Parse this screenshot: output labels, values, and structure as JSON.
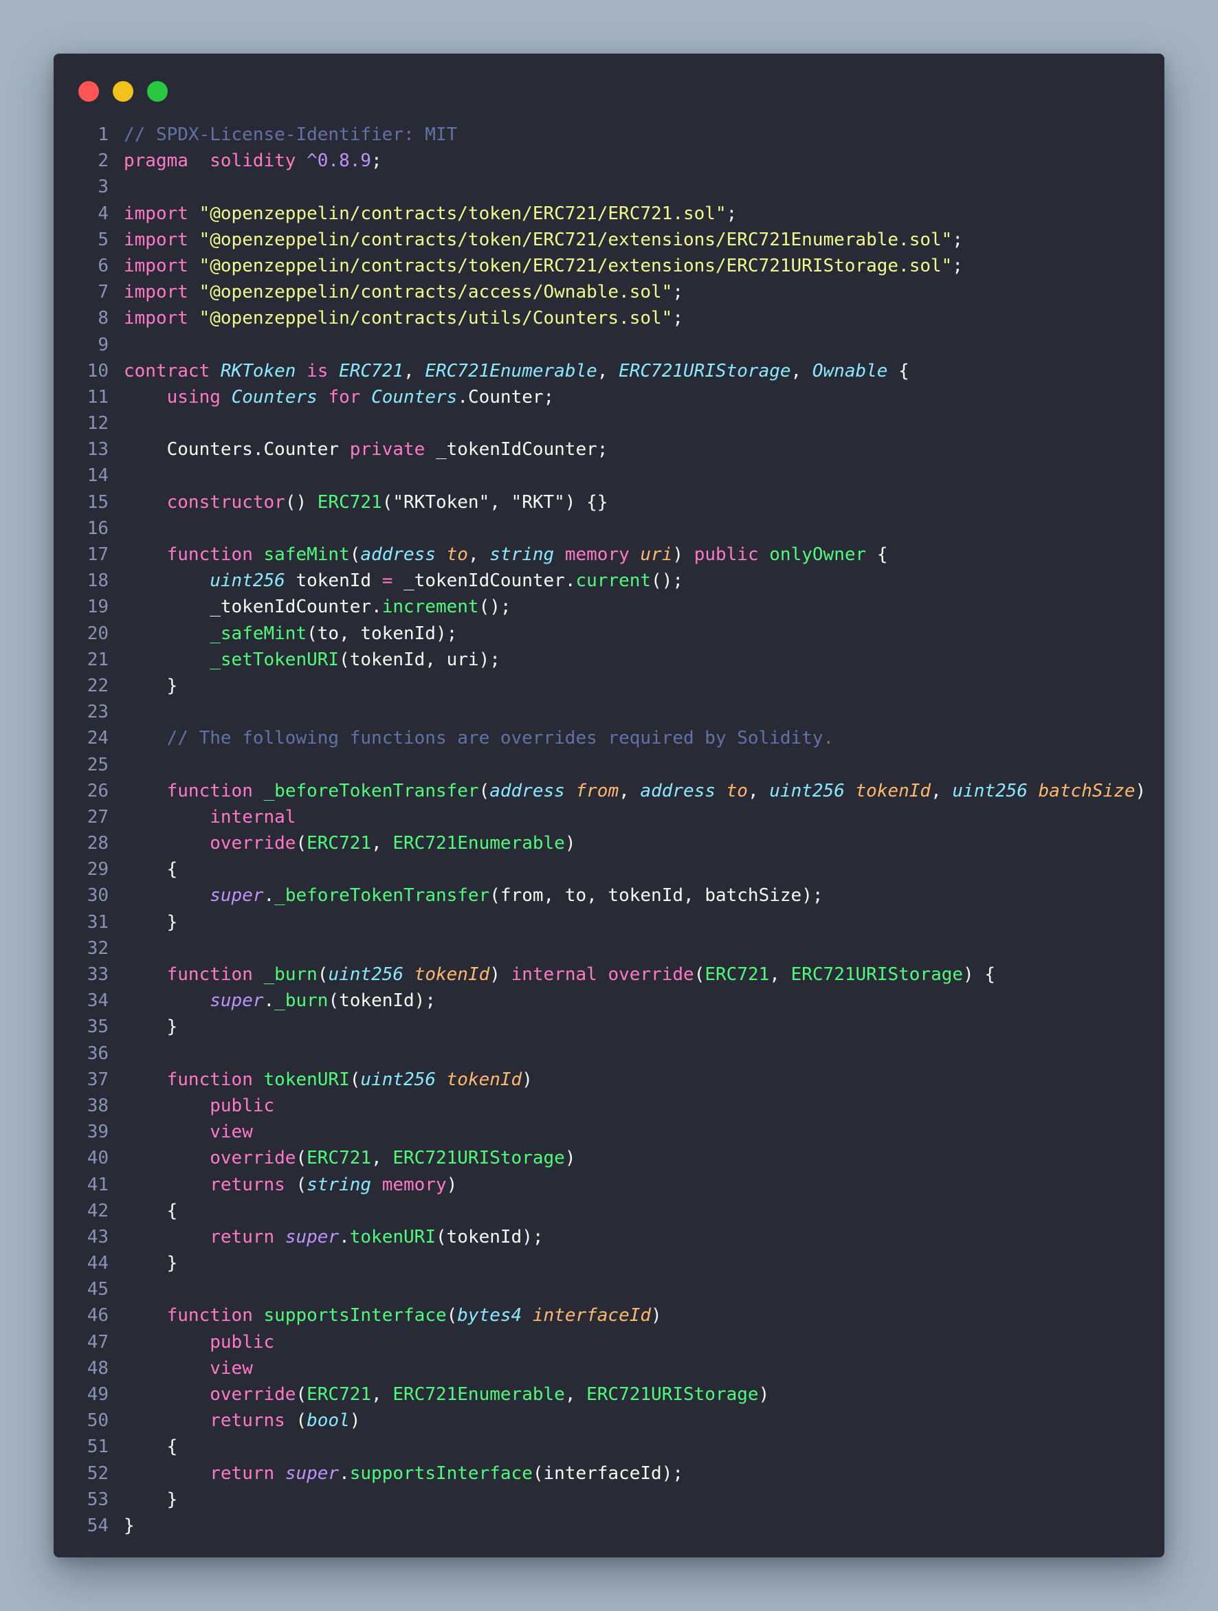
{
  "window": {
    "controls": [
      "close",
      "minimize",
      "maximize"
    ]
  },
  "colors": {
    "background": "#a5b3c1",
    "editor_bg": "#282a36",
    "comment": "#6272a4",
    "keyword": "#ff79c6",
    "string": "#f1fa8c",
    "number": "#bd93f9",
    "type": "#8be9fd",
    "function": "#50fa7b",
    "param": "#ffb86c",
    "plain": "#f8f8f2"
  },
  "lines": [
    [
      [
        "c",
        "// SPDX-License-Identifier: MIT"
      ]
    ],
    [
      [
        "k",
        "pragma"
      ],
      [
        "",
        "  "
      ],
      [
        "k",
        "solidity"
      ],
      [
        "",
        " "
      ],
      [
        "n",
        "^0.8.9"
      ],
      [
        "",
        ";"
      ]
    ],
    [],
    [
      [
        "k",
        "import"
      ],
      [
        "",
        " "
      ],
      [
        "s",
        "\"@openzeppelin/contracts/token/ERC721/ERC721.sol\""
      ],
      [
        "",
        ";"
      ]
    ],
    [
      [
        "k",
        "import"
      ],
      [
        "",
        " "
      ],
      [
        "s",
        "\"@openzeppelin/contracts/token/ERC721/extensions/ERC721Enumerable.sol\""
      ],
      [
        "",
        ";"
      ]
    ],
    [
      [
        "k",
        "import"
      ],
      [
        "",
        " "
      ],
      [
        "s",
        "\"@openzeppelin/contracts/token/ERC721/extensions/ERC721URIStorage.sol\""
      ],
      [
        "",
        ";"
      ]
    ],
    [
      [
        "k",
        "import"
      ],
      [
        "",
        " "
      ],
      [
        "s",
        "\"@openzeppelin/contracts/access/Ownable.sol\""
      ],
      [
        "",
        ";"
      ]
    ],
    [
      [
        "k",
        "import"
      ],
      [
        "",
        " "
      ],
      [
        "s",
        "\"@openzeppelin/contracts/utils/Counters.sol\""
      ],
      [
        "",
        ";"
      ]
    ],
    [],
    [
      [
        "k",
        "contract"
      ],
      [
        "",
        " "
      ],
      [
        "t",
        "RKToken"
      ],
      [
        "",
        " "
      ],
      [
        "k",
        "is"
      ],
      [
        "",
        " "
      ],
      [
        "t",
        "ERC721"
      ],
      [
        "",
        ", "
      ],
      [
        "t",
        "ERC721Enumerable"
      ],
      [
        "",
        ", "
      ],
      [
        "t",
        "ERC721URIStorage"
      ],
      [
        "",
        ", "
      ],
      [
        "t",
        "Ownable"
      ],
      [
        "",
        " {"
      ]
    ],
    [
      [
        "",
        "    "
      ],
      [
        "k",
        "using"
      ],
      [
        "",
        " "
      ],
      [
        "t",
        "Counters"
      ],
      [
        "",
        " "
      ],
      [
        "k",
        "for"
      ],
      [
        "",
        " "
      ],
      [
        "t",
        "Counters"
      ],
      [
        "",
        ".Counter;"
      ]
    ],
    [],
    [
      [
        "",
        "    Counters.Counter "
      ],
      [
        "k",
        "private"
      ],
      [
        "",
        " _tokenIdCounter;"
      ]
    ],
    [],
    [
      [
        "",
        "    "
      ],
      [
        "k",
        "constructor"
      ],
      [
        "",
        "() "
      ],
      [
        "f",
        "ERC721"
      ],
      [
        "",
        "(\"RKToken\", \"RKT\") {}"
      ]
    ],
    [],
    [
      [
        "",
        "    "
      ],
      [
        "k",
        "function"
      ],
      [
        "",
        " "
      ],
      [
        "f",
        "safeMint"
      ],
      [
        "",
        "("
      ],
      [
        "t",
        "address"
      ],
      [
        "",
        " "
      ],
      [
        "p",
        "to"
      ],
      [
        "",
        ", "
      ],
      [
        "t",
        "string"
      ],
      [
        "",
        " "
      ],
      [
        "k",
        "memory"
      ],
      [
        "",
        " "
      ],
      [
        "p",
        "uri"
      ],
      [
        "",
        ") "
      ],
      [
        "k",
        "public"
      ],
      [
        "",
        " "
      ],
      [
        "f",
        "onlyOwner"
      ],
      [
        "",
        " {"
      ]
    ],
    [
      [
        "",
        "        "
      ],
      [
        "t",
        "uint256"
      ],
      [
        "",
        " tokenId "
      ],
      [
        "k",
        "="
      ],
      [
        "",
        " _tokenIdCounter."
      ],
      [
        "f",
        "current"
      ],
      [
        "",
        "();"
      ]
    ],
    [
      [
        "",
        "        _tokenIdCounter."
      ],
      [
        "f",
        "increment"
      ],
      [
        "",
        "();"
      ]
    ],
    [
      [
        "",
        "        "
      ],
      [
        "f",
        "_safeMint"
      ],
      [
        "",
        "(to, tokenId);"
      ]
    ],
    [
      [
        "",
        "        "
      ],
      [
        "f",
        "_setTokenURI"
      ],
      [
        "",
        "(tokenId, uri);"
      ]
    ],
    [
      [
        "",
        "    }"
      ]
    ],
    [],
    [
      [
        "",
        "    "
      ],
      [
        "c",
        "// The following functions are overrides required by Solidity."
      ]
    ],
    [],
    [
      [
        "",
        "    "
      ],
      [
        "k",
        "function"
      ],
      [
        "",
        " "
      ],
      [
        "f",
        "_beforeTokenTransfer"
      ],
      [
        "",
        "("
      ],
      [
        "t",
        "address"
      ],
      [
        "",
        " "
      ],
      [
        "p",
        "from"
      ],
      [
        "",
        ", "
      ],
      [
        "t",
        "address"
      ],
      [
        "",
        " "
      ],
      [
        "p",
        "to"
      ],
      [
        "",
        ", "
      ],
      [
        "t",
        "uint256"
      ],
      [
        "",
        " "
      ],
      [
        "p",
        "tokenId"
      ],
      [
        "",
        ", "
      ],
      [
        "t",
        "uint256"
      ],
      [
        "",
        " "
      ],
      [
        "p",
        "batchSize"
      ],
      [
        "",
        ")"
      ]
    ],
    [
      [
        "",
        "        "
      ],
      [
        "k",
        "internal"
      ]
    ],
    [
      [
        "",
        "        "
      ],
      [
        "k",
        "override"
      ],
      [
        "",
        "("
      ],
      [
        "f",
        "ERC721"
      ],
      [
        "",
        ", "
      ],
      [
        "f",
        "ERC721Enumerable"
      ],
      [
        "",
        ")"
      ]
    ],
    [
      [
        "",
        "    {"
      ]
    ],
    [
      [
        "",
        "        "
      ],
      [
        "v",
        "super"
      ],
      [
        "",
        "."
      ],
      [
        "f",
        "_beforeTokenTransfer"
      ],
      [
        "",
        "(from, to, tokenId, batchSize);"
      ]
    ],
    [
      [
        "",
        "    }"
      ]
    ],
    [],
    [
      [
        "",
        "    "
      ],
      [
        "k",
        "function"
      ],
      [
        "",
        " "
      ],
      [
        "f",
        "_burn"
      ],
      [
        "",
        "("
      ],
      [
        "t",
        "uint256"
      ],
      [
        "",
        " "
      ],
      [
        "p",
        "tokenId"
      ],
      [
        "",
        ") "
      ],
      [
        "k",
        "internal"
      ],
      [
        "",
        " "
      ],
      [
        "k",
        "override"
      ],
      [
        "",
        "("
      ],
      [
        "f",
        "ERC721"
      ],
      [
        "",
        ", "
      ],
      [
        "f",
        "ERC721URIStorage"
      ],
      [
        "",
        ") {"
      ]
    ],
    [
      [
        "",
        "        "
      ],
      [
        "v",
        "super"
      ],
      [
        "",
        "."
      ],
      [
        "f",
        "_burn"
      ],
      [
        "",
        "(tokenId);"
      ]
    ],
    [
      [
        "",
        "    }"
      ]
    ],
    [],
    [
      [
        "",
        "    "
      ],
      [
        "k",
        "function"
      ],
      [
        "",
        " "
      ],
      [
        "f",
        "tokenURI"
      ],
      [
        "",
        "("
      ],
      [
        "t",
        "uint256"
      ],
      [
        "",
        " "
      ],
      [
        "p",
        "tokenId"
      ],
      [
        "",
        ")"
      ]
    ],
    [
      [
        "",
        "        "
      ],
      [
        "k",
        "public"
      ]
    ],
    [
      [
        "",
        "        "
      ],
      [
        "k",
        "view"
      ]
    ],
    [
      [
        "",
        "        "
      ],
      [
        "k",
        "override"
      ],
      [
        "",
        "("
      ],
      [
        "f",
        "ERC721"
      ],
      [
        "",
        ", "
      ],
      [
        "f",
        "ERC721URIStorage"
      ],
      [
        "",
        ")"
      ]
    ],
    [
      [
        "",
        "        "
      ],
      [
        "k",
        "returns"
      ],
      [
        "",
        " ("
      ],
      [
        "t",
        "string"
      ],
      [
        "",
        " "
      ],
      [
        "k",
        "memory"
      ],
      [
        "",
        ")"
      ]
    ],
    [
      [
        "",
        "    {"
      ]
    ],
    [
      [
        "",
        "        "
      ],
      [
        "k",
        "return"
      ],
      [
        "",
        " "
      ],
      [
        "v",
        "super"
      ],
      [
        "",
        "."
      ],
      [
        "f",
        "tokenURI"
      ],
      [
        "",
        "(tokenId);"
      ]
    ],
    [
      [
        "",
        "    }"
      ]
    ],
    [],
    [
      [
        "",
        "    "
      ],
      [
        "k",
        "function"
      ],
      [
        "",
        " "
      ],
      [
        "f",
        "supportsInterface"
      ],
      [
        "",
        "("
      ],
      [
        "t",
        "bytes4"
      ],
      [
        "",
        " "
      ],
      [
        "p",
        "interfaceId"
      ],
      [
        "",
        ")"
      ]
    ],
    [
      [
        "",
        "        "
      ],
      [
        "k",
        "public"
      ]
    ],
    [
      [
        "",
        "        "
      ],
      [
        "k",
        "view"
      ]
    ],
    [
      [
        "",
        "        "
      ],
      [
        "k",
        "override"
      ],
      [
        "",
        "("
      ],
      [
        "f",
        "ERC721"
      ],
      [
        "",
        ", "
      ],
      [
        "f",
        "ERC721Enumerable"
      ],
      [
        "",
        ", "
      ],
      [
        "f",
        "ERC721URIStorage"
      ],
      [
        "",
        ")"
      ]
    ],
    [
      [
        "",
        "        "
      ],
      [
        "k",
        "returns"
      ],
      [
        "",
        " ("
      ],
      [
        "t",
        "bool"
      ],
      [
        "",
        ")"
      ]
    ],
    [
      [
        "",
        "    {"
      ]
    ],
    [
      [
        "",
        "        "
      ],
      [
        "k",
        "return"
      ],
      [
        "",
        " "
      ],
      [
        "v",
        "super"
      ],
      [
        "",
        "."
      ],
      [
        "f",
        "supportsInterface"
      ],
      [
        "",
        "(interfaceId);"
      ]
    ],
    [
      [
        "",
        "    }"
      ]
    ],
    [
      [
        "",
        "}"
      ]
    ]
  ]
}
